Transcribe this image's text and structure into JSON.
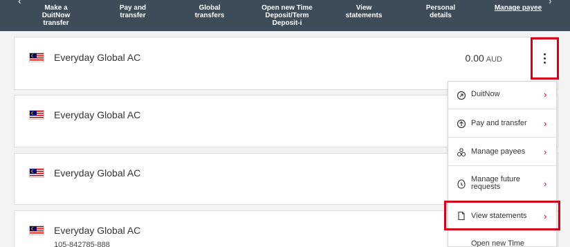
{
  "nav": {
    "items": [
      {
        "label_lines": [
          "Make a",
          "DuitNow",
          "transfer"
        ]
      },
      {
        "label_lines": [
          "Pay and",
          "transfer"
        ]
      },
      {
        "label_lines": [
          "Global transfers"
        ]
      },
      {
        "label_lines": [
          "Open new Time",
          "Deposit/Term",
          "Deposit-i"
        ]
      },
      {
        "label_lines": [
          "View",
          "statements"
        ]
      },
      {
        "label_lines": [
          "Personal details"
        ]
      },
      {
        "label_lines": [
          "Manage payee"
        ]
      }
    ],
    "prev_glyph": "‹",
    "next_glyph": "›"
  },
  "accounts": [
    {
      "name": "Everyday Global AC",
      "balance": "0.00",
      "currency": "AUD",
      "flag": "malaysia-flag"
    },
    {
      "name": "Everyday Global AC",
      "flag": "malaysia-flag"
    },
    {
      "name": "Everyday Global AC",
      "flag": "malaysia-flag"
    },
    {
      "name": "Everyday Global AC",
      "number": "105-842785-888",
      "flag": "malaysia-flag"
    }
  ],
  "menu": {
    "items": [
      {
        "label_lines": [
          "DuitNow"
        ],
        "icon": "duitnow-icon"
      },
      {
        "label_lines": [
          "Pay and transfer"
        ],
        "icon": "upload-arrow-icon"
      },
      {
        "label_lines": [
          "Manage payees"
        ],
        "icon": "payees-icon"
      },
      {
        "label_lines": [
          "Manage future",
          "requests"
        ],
        "icon": "future-requests-icon"
      },
      {
        "label_lines": [
          "View statements"
        ],
        "icon": "document-icon"
      },
      {
        "label_lines": [
          "Open new Time"
        ],
        "icon": ""
      }
    ],
    "chevron": "›"
  },
  "colors": {
    "nav_bg": "#3e4c59",
    "accent_red": "#d4001a",
    "page_bg": "#f3f3f3"
  }
}
